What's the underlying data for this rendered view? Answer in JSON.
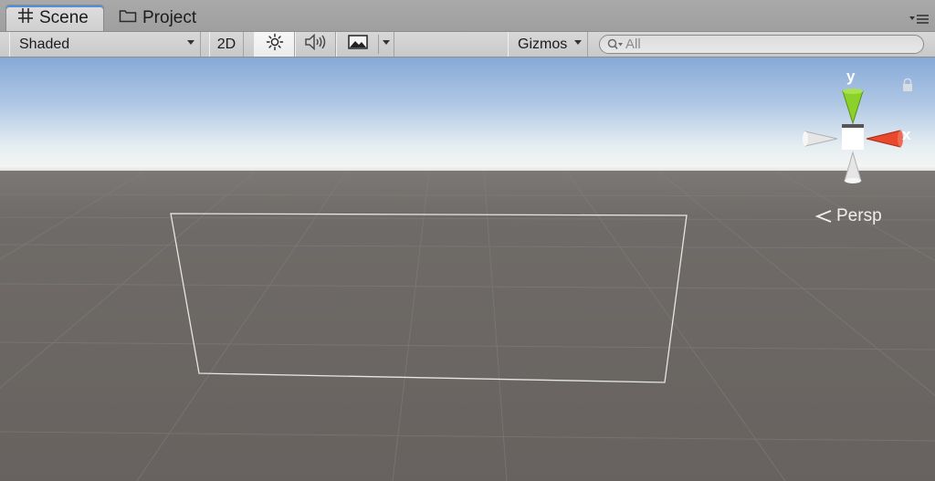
{
  "tabs": [
    {
      "label": "Scene",
      "icon": "grid-icon",
      "active": true
    },
    {
      "label": "Project",
      "icon": "folder-icon",
      "active": false
    }
  ],
  "toolbar": {
    "shading_mode": "Shaded",
    "mode_2d": "2D",
    "gizmos_label": "Gizmos",
    "search_placeholder": "All"
  },
  "viewport": {
    "projection_label": "Persp",
    "gizmo_axes": {
      "y": "y",
      "x": "x"
    }
  },
  "colors": {
    "sky_top": "#86a9d8",
    "horizon": "#f2f4f4",
    "ground": "#6b6663",
    "y_axis": "#8bd12a",
    "x_axis": "#e8492c",
    "selection_outline": "#e8e8e8"
  }
}
